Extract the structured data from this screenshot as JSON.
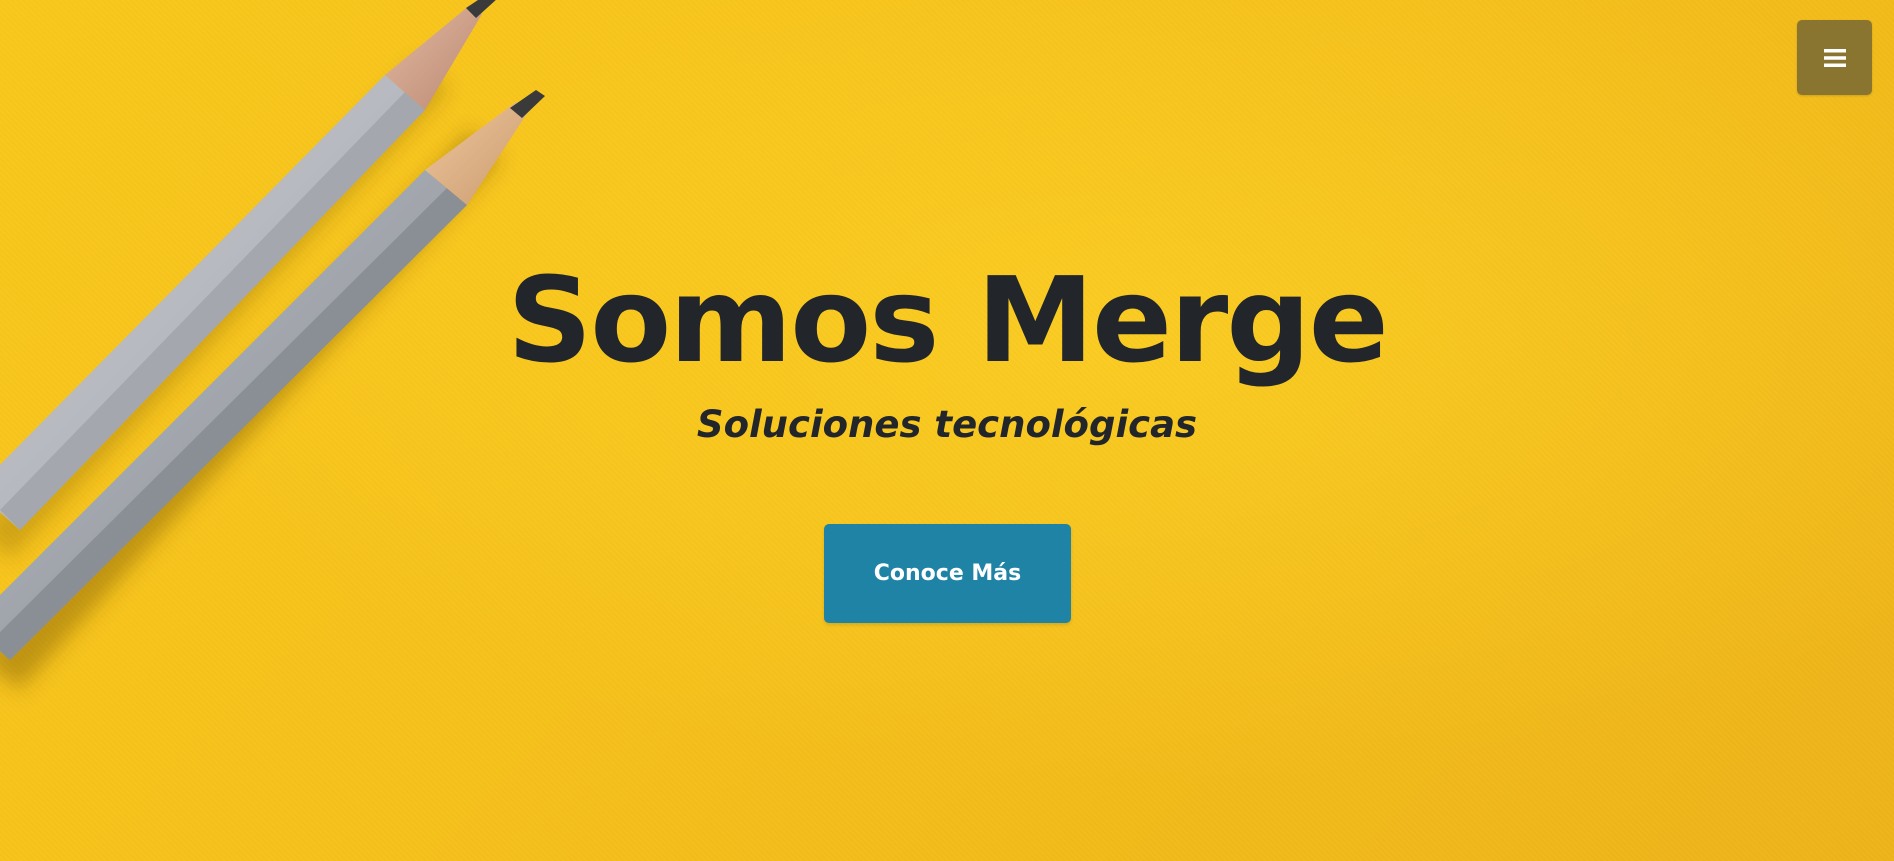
{
  "hero": {
    "title": "Somos Merge",
    "subtitle": "Soluciones tecnológicas",
    "cta_label": "Conoce Más",
    "background_color": "#f9c81c",
    "decoration": "two-pencils-image"
  },
  "nav": {
    "menu_icon": "hamburger-menu-icon",
    "menu_button_color": "#8a7530"
  },
  "colors": {
    "title_text": "#22262b",
    "cta_background": "#1f83a5",
    "cta_text": "#ffffff"
  }
}
